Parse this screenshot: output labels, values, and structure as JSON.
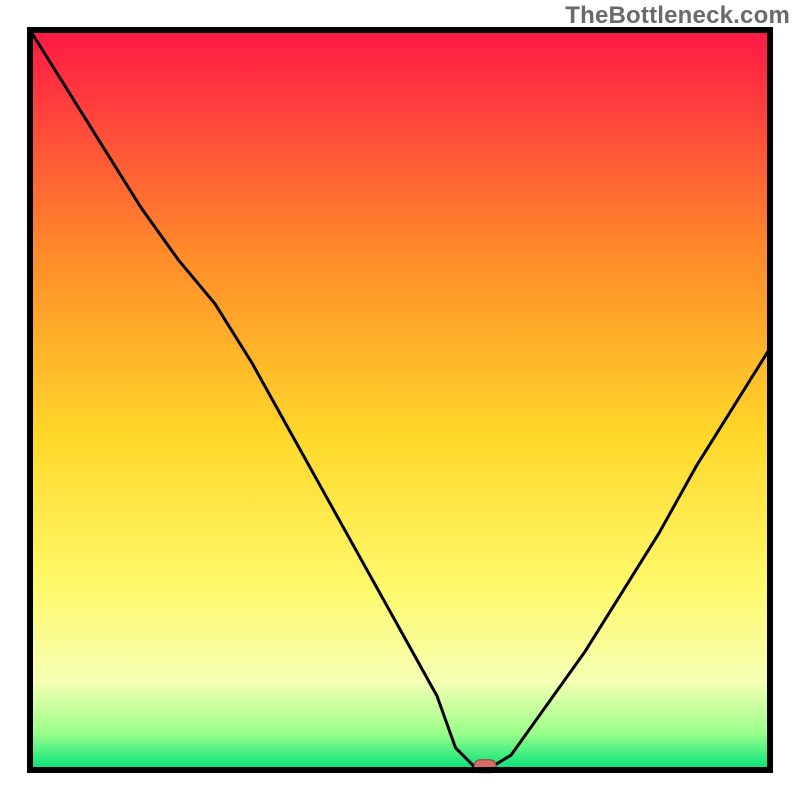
{
  "watermark": "TheBottleneck.com",
  "chart_data": {
    "type": "line",
    "title": "",
    "xlabel": "",
    "ylabel": "",
    "x": [
      0.0,
      0.05,
      0.1,
      0.15,
      0.2,
      0.25,
      0.3,
      0.35,
      0.4,
      0.45,
      0.5,
      0.55,
      0.575,
      0.6,
      0.625,
      0.65,
      0.7,
      0.75,
      0.8,
      0.85,
      0.9,
      0.95,
      1.0
    ],
    "values": [
      100,
      92,
      84,
      76,
      69,
      63,
      55,
      46,
      37,
      28,
      19,
      10,
      3,
      0.5,
      0.5,
      2,
      9,
      16,
      24,
      32,
      41,
      49,
      57
    ],
    "ylim": [
      0,
      100
    ],
    "xlim": [
      0,
      1
    ],
    "marker": {
      "x": 0.615,
      "y": 0.5,
      "color": "#d96a6a"
    },
    "background_gradient": {
      "top": "#ff1846",
      "mid_upper": "#ff8a2a",
      "mid": "#ffd82a",
      "mid_lower": "#fff96a",
      "lower_band": "#f6ffb4",
      "green_top": "#9bff8a",
      "green_bottom": "#00e07a"
    },
    "border_color": "#000000"
  }
}
